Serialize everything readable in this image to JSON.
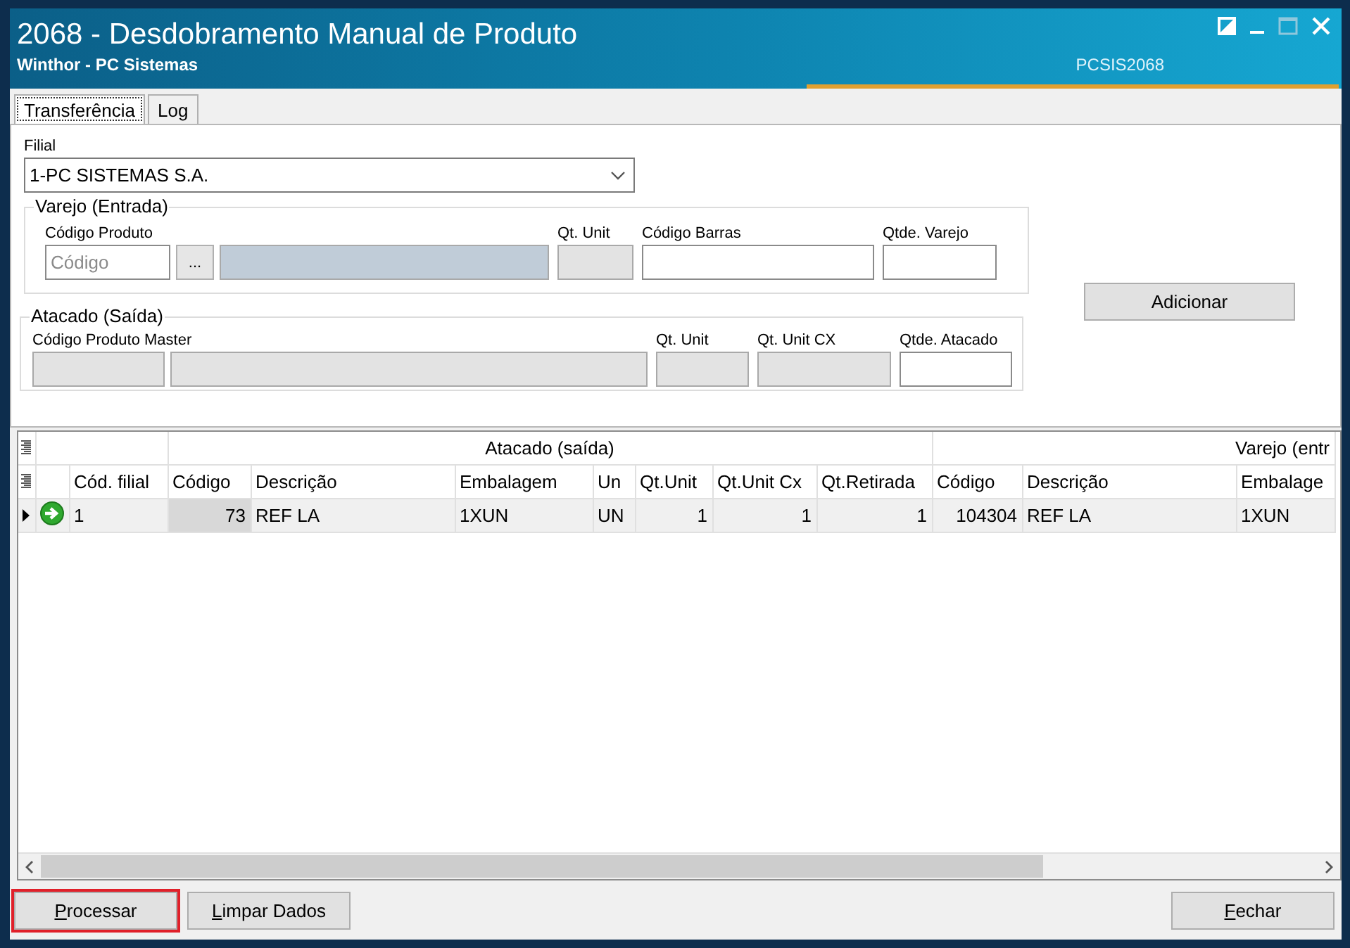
{
  "window": {
    "title": "2068 - Desdobramento Manual de Produto",
    "subtitle": "Winthor - PC Sistemas",
    "code": "PCSIS2068"
  },
  "tabs": [
    {
      "label": "Transferência",
      "selected": true
    },
    {
      "label": "Log",
      "selected": false
    }
  ],
  "filial": {
    "label": "Filial",
    "value": "1-PC SISTEMAS S.A."
  },
  "varejo": {
    "legend": "Varejo (Entrada)",
    "fields": [
      {
        "label": "Código Produto",
        "controls": [
          {
            "kind": "input",
            "placeholder": "Código"
          },
          {
            "kind": "button",
            "label": "..."
          },
          {
            "kind": "lookup"
          }
        ]
      },
      {
        "label": "Qt. Unit",
        "controls": [
          {
            "kind": "readonly"
          }
        ]
      },
      {
        "label": "Código Barras",
        "controls": [
          {
            "kind": "input"
          }
        ]
      },
      {
        "label": "Qtde. Varejo",
        "controls": [
          {
            "kind": "input"
          }
        ]
      }
    ]
  },
  "add_button": {
    "label": "Adicionar"
  },
  "atacado": {
    "legend": "Atacado (Saída)",
    "fields": [
      {
        "label": "Código Produto Master",
        "controls": [
          {
            "kind": "readonly"
          },
          {
            "kind": "readonly"
          }
        ]
      },
      {
        "label": "Qt. Unit",
        "controls": [
          {
            "kind": "readonly"
          }
        ]
      },
      {
        "label": "Qt. Unit CX",
        "controls": [
          {
            "kind": "readonly"
          }
        ]
      },
      {
        "label": "Qtde. Atacado",
        "controls": [
          {
            "kind": "input"
          }
        ]
      }
    ]
  },
  "grid": {
    "columns": [
      {
        "label": "Cód. filial",
        "numeric": false,
        "shaded": false
      }
    ],
    "column_groups": [
      {
        "label": "Atacado (saída)",
        "columns": [
          {
            "label": "Código",
            "numeric": true,
            "shaded": true
          },
          {
            "label": "Descrição",
            "numeric": false,
            "shaded": false
          },
          {
            "label": "Embalagem",
            "numeric": false,
            "shaded": false
          },
          {
            "label": "Un",
            "numeric": false,
            "shaded": false
          },
          {
            "label": "Qt.Unit",
            "numeric": true,
            "shaded": false
          },
          {
            "label": "Qt.Unit Cx",
            "numeric": true,
            "shaded": false
          },
          {
            "label": "Qt.Retirada",
            "numeric": true,
            "shaded": false
          }
        ]
      },
      {
        "label": "Varejo (entr",
        "columns": [
          {
            "label": "Código",
            "numeric": true,
            "shaded": false
          },
          {
            "label": "Descrição",
            "numeric": false,
            "shaded": false
          },
          {
            "label": "Embalage",
            "numeric": false,
            "shaded": false
          }
        ]
      }
    ],
    "rows": [
      {
        "current": true,
        "cells": [
          "1",
          "73",
          "REF  LA",
          "1XUN",
          "UN",
          "1",
          "1",
          "1",
          "104304",
          "REF  LA",
          "1XUN"
        ]
      }
    ]
  },
  "left_buttons": [
    {
      "accel": "P",
      "rest": "rocessar",
      "highlighted": true
    },
    {
      "accel": "L",
      "rest": "impar Dados",
      "highlighted": false
    }
  ],
  "right_buttons": [
    {
      "accel": "F",
      "rest": "echar",
      "highlighted": false
    }
  ]
}
